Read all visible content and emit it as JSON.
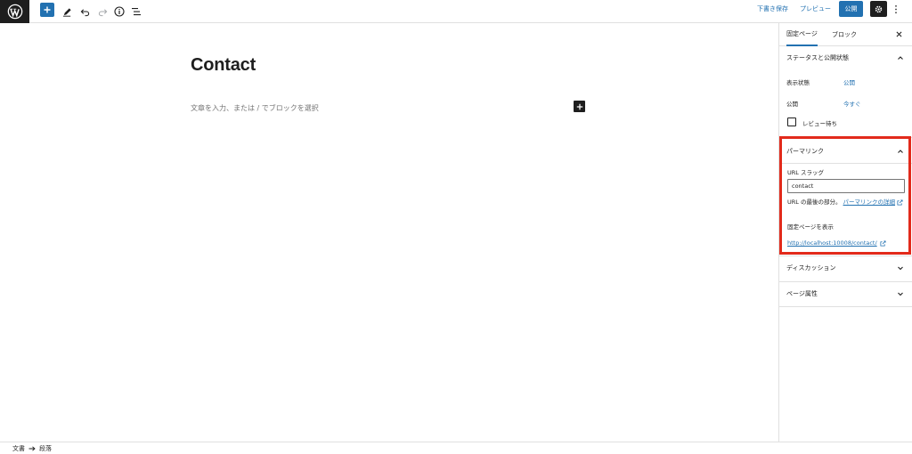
{
  "toolbar": {
    "save_draft": "下書き保存",
    "preview": "プレビュー",
    "publish": "公開"
  },
  "editor": {
    "title": "Contact",
    "placeholder": "文章を入力、または / でブロックを選択"
  },
  "sidebar": {
    "tabs": [
      "固定ページ",
      "ブロック"
    ],
    "status_panel": {
      "title": "ステータスと公開状態",
      "visibility_label": "表示状態",
      "visibility_value": "公開",
      "publish_label": "公開",
      "publish_value": "今すぐ",
      "pending_review": "レビュー待ち"
    },
    "permalink_panel": {
      "title": "パーマリンク",
      "slug_label": "URL スラッグ",
      "slug_value": "contact",
      "help_text": "URL の最後の部分。",
      "help_link": "パーマリンクの詳細",
      "view_label": "固定ページを表示",
      "url": "http://localhost:10008/contact/"
    },
    "discussion_title": "ディスカッション",
    "page_attributes_title": "ページ属性"
  },
  "footer": {
    "breadcrumb": [
      "文書",
      "段落"
    ]
  },
  "colors": {
    "accent": "#2271b1",
    "highlight": "#e22a1b",
    "dark": "#1e1e1e"
  }
}
